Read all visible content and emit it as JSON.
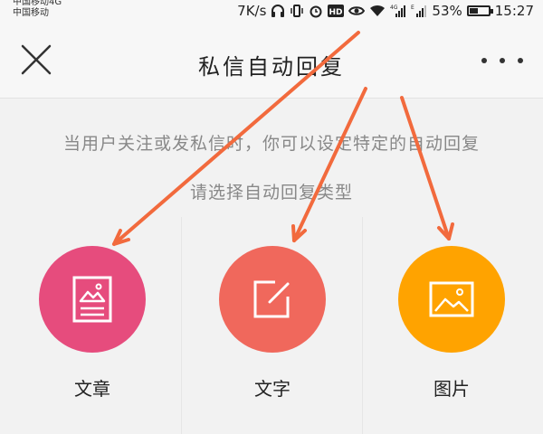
{
  "status_bar": {
    "carrier_1": "中国移动4G",
    "carrier_2": "中国移动",
    "speed": "7K/s",
    "battery_percent": "53%",
    "battery_level": 0.53,
    "time": "15:27",
    "icons": [
      "headphones-icon",
      "vibrate-icon",
      "alarm-icon",
      "hd-icon",
      "eye-icon",
      "wifi-icon",
      "signal-4g-icon",
      "signal-e-icon",
      "battery-icon"
    ]
  },
  "header": {
    "title": "私信自动回复",
    "close_icon": "close-icon",
    "more_icon": "more-icon"
  },
  "main": {
    "description": "当用户关注或发私信时，你可以设定特定的自动回复",
    "prompt": "请选择自动回复类型",
    "options": [
      {
        "label": "文章",
        "icon": "article-icon",
        "color": "#e64c7d"
      },
      {
        "label": "文字",
        "icon": "text-edit-icon",
        "color": "#f0685c"
      },
      {
        "label": "图片",
        "icon": "image-icon",
        "color": "#ffa300"
      }
    ]
  },
  "colors": {
    "arrow": "#f26a3d",
    "background": "#f2f2f2",
    "header_background": "#f7f7f7"
  }
}
